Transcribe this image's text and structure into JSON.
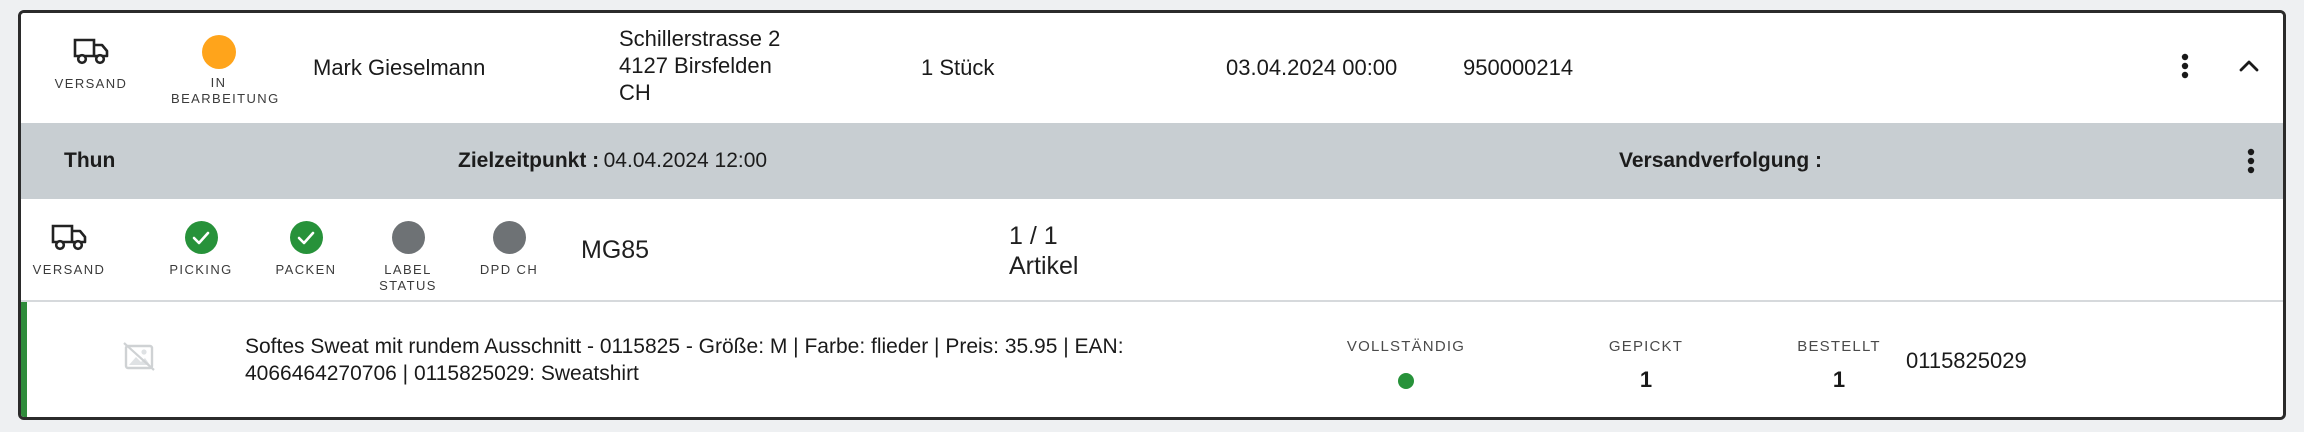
{
  "order": {
    "shipping_type_label": "VERSAND",
    "status_label": "IN BEARBEITUNG",
    "status_color": "#ffa41b",
    "customer_name": "Mark Gieselmann",
    "address": {
      "street": "Schillerstrasse 2",
      "city": "4127 Birsfelden",
      "country": "CH"
    },
    "quantity": "1 Stück",
    "date": "03.04.2024 00:00",
    "order_number": "950000214",
    "actions": {
      "more_icon": "more-vertical-icon",
      "collapse_icon": "chevron-up-icon"
    }
  },
  "location_bar": {
    "location": "Thun",
    "target_time_label": "Zielzeitpunkt :",
    "target_time_value": "04.04.2024 12:00",
    "tracking_label": "Versandverfolgung :",
    "more_icon": "more-vertical-icon",
    "background": "#c8ced2"
  },
  "shipment": {
    "steps": [
      {
        "label": "VERSAND",
        "icon": "truck-icon",
        "state": "icon"
      },
      {
        "label": "PICKING",
        "icon": "check-icon",
        "state": "done"
      },
      {
        "label": "PACKEN",
        "icon": "check-icon",
        "state": "done"
      },
      {
        "label_line1": "LABEL",
        "label_line2": "STATUS",
        "state": "pending"
      },
      {
        "label": "DPD CH",
        "state": "pending"
      }
    ],
    "code": "MG85",
    "count": "1 / 1",
    "count_unit": "Artikel",
    "done_color": "#27923a",
    "pending_color": "#6e7275"
  },
  "article": {
    "image_icon": "image-placeholder-icon",
    "description_line1": "Softes Sweat mit rundem Ausschnitt - 0115825 - Größe: M | Farbe: flieder | Preis: 35.95 | EAN:",
    "description_line2": "4066464270706 | 0115825029: Sweatshirt",
    "complete_label": "VOLLSTÄNDIG",
    "picked_label": "GEPICKT",
    "picked_value": "1",
    "ordered_label": "BESTELLT",
    "ordered_value": "1",
    "article_number": "0115825029",
    "accent_color": "#2e8b3a"
  }
}
